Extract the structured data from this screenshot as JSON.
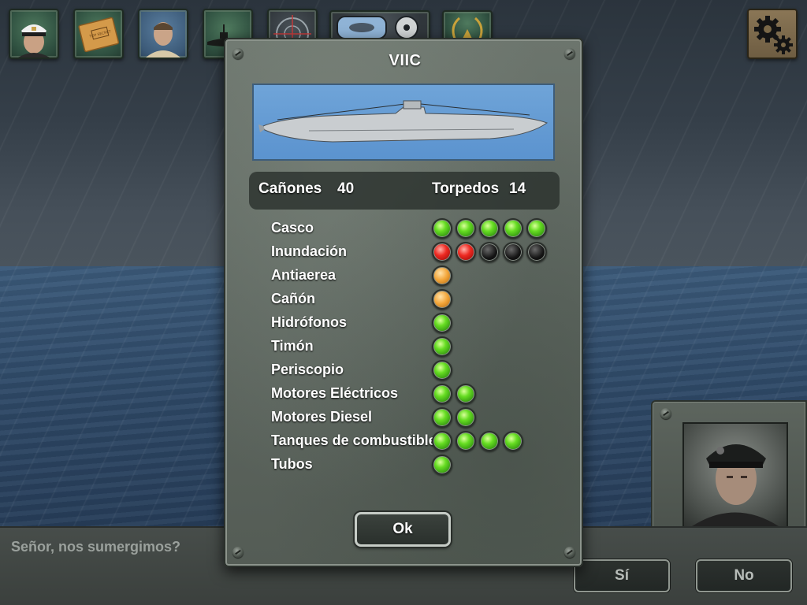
{
  "toolbar": {
    "buttons": [
      {
        "name": "captain-portrait-button",
        "icon": "captain-portrait-icon"
      },
      {
        "name": "top-secret-folder-button",
        "icon": "folder-icon",
        "stamp": "TOP SECRET"
      },
      {
        "name": "crew-portrait-button",
        "icon": "crew-portrait-icon"
      },
      {
        "name": "submarine-button",
        "icon": "submarine-icon"
      },
      {
        "name": "periscope-button",
        "icon": "crosshair-icon"
      },
      {
        "name": "sonar-button",
        "icon": "sonar-icon"
      },
      {
        "name": "rank-button",
        "icon": "rank-insignia-icon"
      }
    ],
    "settings_icon": "gear-icon"
  },
  "dialog": {
    "title": "VIIC",
    "stats": {
      "guns_label": "Cañones",
      "guns_value": "40",
      "torpedoes_label": "Torpedos",
      "torpedoes_value": "14"
    },
    "systems": [
      {
        "label": "Casco",
        "lights": [
          "green",
          "green",
          "green",
          "green",
          "green"
        ]
      },
      {
        "label": "Inundación",
        "lights": [
          "red",
          "red",
          "black",
          "black",
          "black"
        ]
      },
      {
        "label": "Antiaerea",
        "lights": [
          "orange"
        ]
      },
      {
        "label": "Cañón",
        "lights": [
          "orange"
        ]
      },
      {
        "label": "Hidrófonos",
        "lights": [
          "green"
        ]
      },
      {
        "label": "Timón",
        "lights": [
          "green"
        ]
      },
      {
        "label": "Periscopio",
        "lights": [
          "green"
        ]
      },
      {
        "label": "Motores Eléctricos",
        "lights": [
          "green",
          "green"
        ]
      },
      {
        "label": "Motores Diesel",
        "lights": [
          "green",
          "green"
        ]
      },
      {
        "label": "Tanques de combustible",
        "lights": [
          "green",
          "green",
          "green",
          "green"
        ]
      },
      {
        "label": "Tubos",
        "lights": [
          "green"
        ]
      }
    ],
    "ok_label": "Ok"
  },
  "bottom": {
    "question": "Señor, nos sumergimos?",
    "yes_label": "Sí",
    "no_label": "No"
  },
  "colors": {
    "light_green": "#66dd22",
    "light_red": "#ee2a22",
    "light_orange": "#f3a63a",
    "light_off": "#151515",
    "sub_image_sky": "#6fa4d8"
  }
}
